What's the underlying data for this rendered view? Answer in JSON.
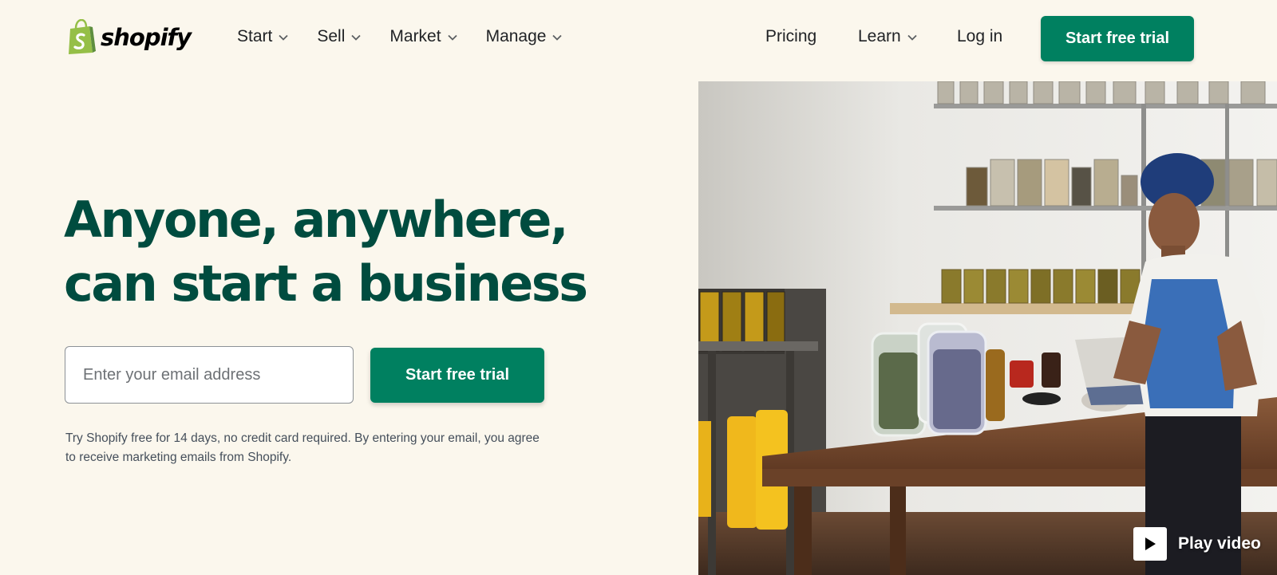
{
  "brand": {
    "name": "shopify",
    "bag_color": "#95bf47",
    "bag_dark": "#5e8e3e"
  },
  "nav": {
    "left_items": [
      {
        "label": "Start",
        "icon": "chevron-down-icon"
      },
      {
        "label": "Sell",
        "icon": "chevron-down-icon"
      },
      {
        "label": "Market",
        "icon": "chevron-down-icon"
      },
      {
        "label": "Manage",
        "icon": "chevron-down-icon"
      }
    ],
    "pricing": "Pricing",
    "learn": "Learn",
    "login": "Log in",
    "cta": "Start free trial"
  },
  "hero": {
    "headline_line1": "Anyone, anywhere,",
    "headline_line2": "can start a business",
    "email_placeholder": "Enter your email address",
    "cta": "Start free trial",
    "disclaimer": "Try Shopify free for 14 days, no credit card required. By entering your email, you agree to receive marketing emails from Shopify.",
    "play_video": "Play video"
  },
  "colors": {
    "background": "#fbf7ed",
    "primary": "#008060",
    "headline": "#004c3f"
  }
}
